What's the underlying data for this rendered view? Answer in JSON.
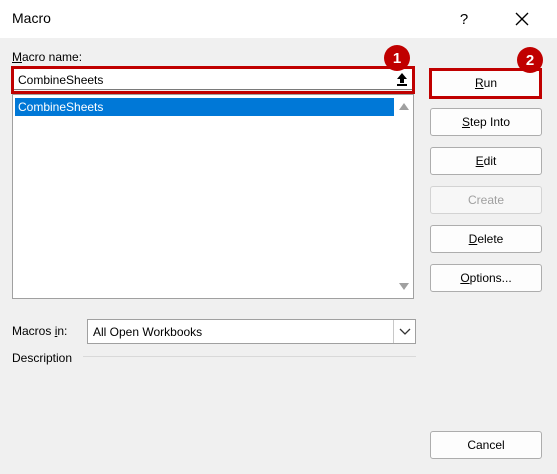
{
  "window": {
    "title": "Macro",
    "help": "?",
    "close": "close"
  },
  "macro_name": {
    "label_first": "M",
    "label_rest": "acro name:",
    "value": "CombineSheets"
  },
  "macro_list": {
    "items": [
      "CombineSheets"
    ]
  },
  "macros_in": {
    "label_pre": "Macros ",
    "label_u": "i",
    "label_post": "n:",
    "value": "All Open Workbooks"
  },
  "description": {
    "label": "Description"
  },
  "buttons": {
    "run": {
      "u": "R",
      "rest": "un"
    },
    "step_into": {
      "u": "S",
      "rest": "tep Into"
    },
    "edit": {
      "u": "E",
      "rest": "dit"
    },
    "create": {
      "label": "Create",
      "enabled": false
    },
    "delete": {
      "u": "D",
      "rest": "elete"
    },
    "options": {
      "u": "O",
      "rest": "ptions..."
    },
    "cancel": {
      "label": "Cancel"
    }
  },
  "annotations": {
    "badge1": "1",
    "badge2": "2",
    "color": "#c00000"
  },
  "icons": {
    "upload": "upload-arrow-icon",
    "chevron": "chevron-down-icon",
    "close": "close-icon"
  },
  "colors": {
    "selection": "#0078d7",
    "background": "#f0f0f0"
  }
}
